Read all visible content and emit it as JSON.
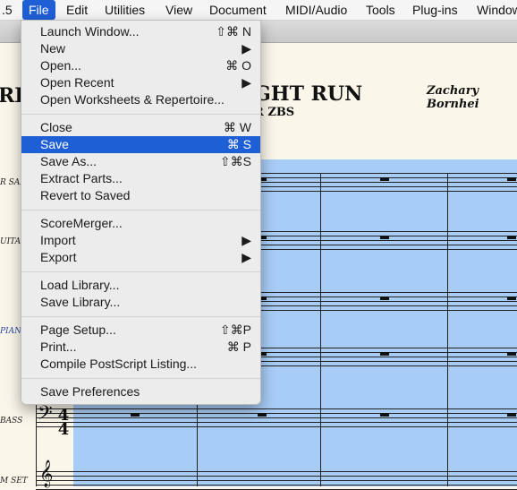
{
  "menubar": {
    "app_partial": ".5",
    "items": [
      "File",
      "Edit",
      "Utilities",
      "View",
      "Document",
      "MIDI/Audio",
      "Tools",
      "Plug-ins",
      "Window"
    ]
  },
  "score": {
    "title_partial": "GHT RUN",
    "left_partial": "RE",
    "subtitle_partial": "R ZBS",
    "composer_partial": "Zachary Bornhei",
    "instruments": [
      "R SAX",
      "UITAR",
      "PIANO",
      "BASS",
      "M SET"
    ],
    "timesig_top": "4",
    "timesig_bottom": "4"
  },
  "file_menu": {
    "groups": [
      [
        {
          "label": "Launch Window...",
          "shortcut": "⇧⌘ N"
        },
        {
          "label": "New",
          "submenu": "▶"
        },
        {
          "label": "Open...",
          "shortcut": "⌘ O"
        },
        {
          "label": "Open Recent",
          "submenu": "▶"
        },
        {
          "label": "Open Worksheets & Repertoire..."
        }
      ],
      [
        {
          "label": "Close",
          "shortcut": "⌘ W"
        },
        {
          "label": "Save",
          "shortcut": "⌘ S",
          "highlighted": true
        },
        {
          "label": "Save As...",
          "shortcut": "⇧⌘S"
        },
        {
          "label": "Extract Parts..."
        },
        {
          "label": "Revert to Saved"
        }
      ],
      [
        {
          "label": "ScoreMerger..."
        },
        {
          "label": "Import",
          "submenu": "▶"
        },
        {
          "label": "Export",
          "submenu": "▶"
        }
      ],
      [
        {
          "label": "Load Library..."
        },
        {
          "label": "Save Library..."
        }
      ],
      [
        {
          "label": "Page Setup...",
          "shortcut": "⇧⌘P"
        },
        {
          "label": "Print...",
          "shortcut": "⌘ P"
        },
        {
          "label": "Compile PostScript Listing..."
        }
      ],
      [
        {
          "label": "Save Preferences"
        }
      ]
    ]
  },
  "colors": {
    "highlight": "#1f5fd6",
    "selection": "#a7ccf5"
  }
}
